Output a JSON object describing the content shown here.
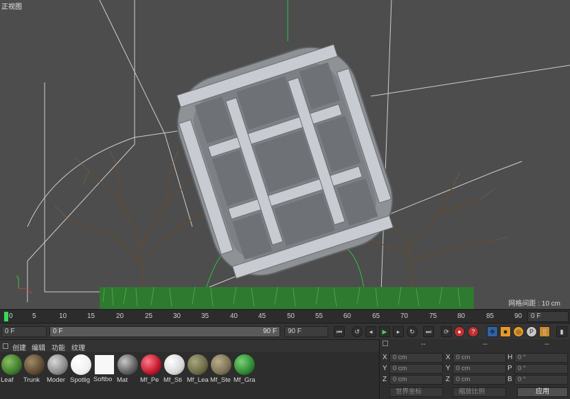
{
  "viewport": {
    "title": "正视图",
    "grid_spacing": "网格间距 : 10 cm"
  },
  "timeline": {
    "ticks": [
      "0",
      "5",
      "10",
      "15",
      "20",
      "25",
      "30",
      "35",
      "40",
      "45",
      "50",
      "55",
      "60",
      "65",
      "70",
      "75",
      "80",
      "85",
      "90"
    ],
    "current_frame_field": "0 F"
  },
  "transport": {
    "start_field": "0 F",
    "slider_left": "0 F",
    "slider_right": "90 F",
    "end_field": "90 F",
    "buttons": [
      "first-frame",
      "prev-key",
      "prev-frame",
      "play",
      "next-frame",
      "next-key",
      "last-frame",
      "loop",
      "record",
      "auto-key",
      "keyframe-help",
      "move",
      "scale",
      "rotate",
      "param",
      "point-level",
      "more"
    ]
  },
  "materials": {
    "menu": [
      "创建",
      "编辑",
      "功能",
      "纹理"
    ],
    "items": [
      {
        "name": "Leaf",
        "color": "#3f7a2e"
      },
      {
        "name": "Trunk",
        "color": "#5e4a32"
      },
      {
        "name": "Moder",
        "color": "#8a8a8a"
      },
      {
        "name": "Spotlig",
        "color": "#f4f4f4"
      },
      {
        "name": "Softbo",
        "color": "#f8f8f8"
      },
      {
        "name": "Mat",
        "color": "#777777"
      },
      {
        "name": "Mf_Pe",
        "color": "#c0182a"
      },
      {
        "name": "Mf_Sti",
        "color": "#d8d8d8"
      },
      {
        "name": "Mf_Lea",
        "color": "#6b6a48"
      },
      {
        "name": "Mf_Ste",
        "color": "#7c7355"
      },
      {
        "name": "Mf_Gra",
        "color": "#2f8a32"
      }
    ]
  },
  "coordinates": {
    "headers": [
      "--",
      "--",
      "--"
    ],
    "position": [
      {
        "axis": "X",
        "value": "0 cm"
      },
      {
        "axis": "Y",
        "value": "0 cm"
      },
      {
        "axis": "Z",
        "value": "0 cm"
      }
    ],
    "size": [
      {
        "axis": "X",
        "value": "0 cm"
      },
      {
        "axis": "Y",
        "value": "0 cm"
      },
      {
        "axis": "Z",
        "value": "0 cm"
      }
    ],
    "rotation": [
      {
        "axis": "H",
        "value": "0 °"
      },
      {
        "axis": "P",
        "value": "0 °"
      },
      {
        "axis": "B",
        "value": "0 °"
      }
    ],
    "mode_select": "世界坐标",
    "scale_select": "缩放比例",
    "apply_button": "应用"
  }
}
